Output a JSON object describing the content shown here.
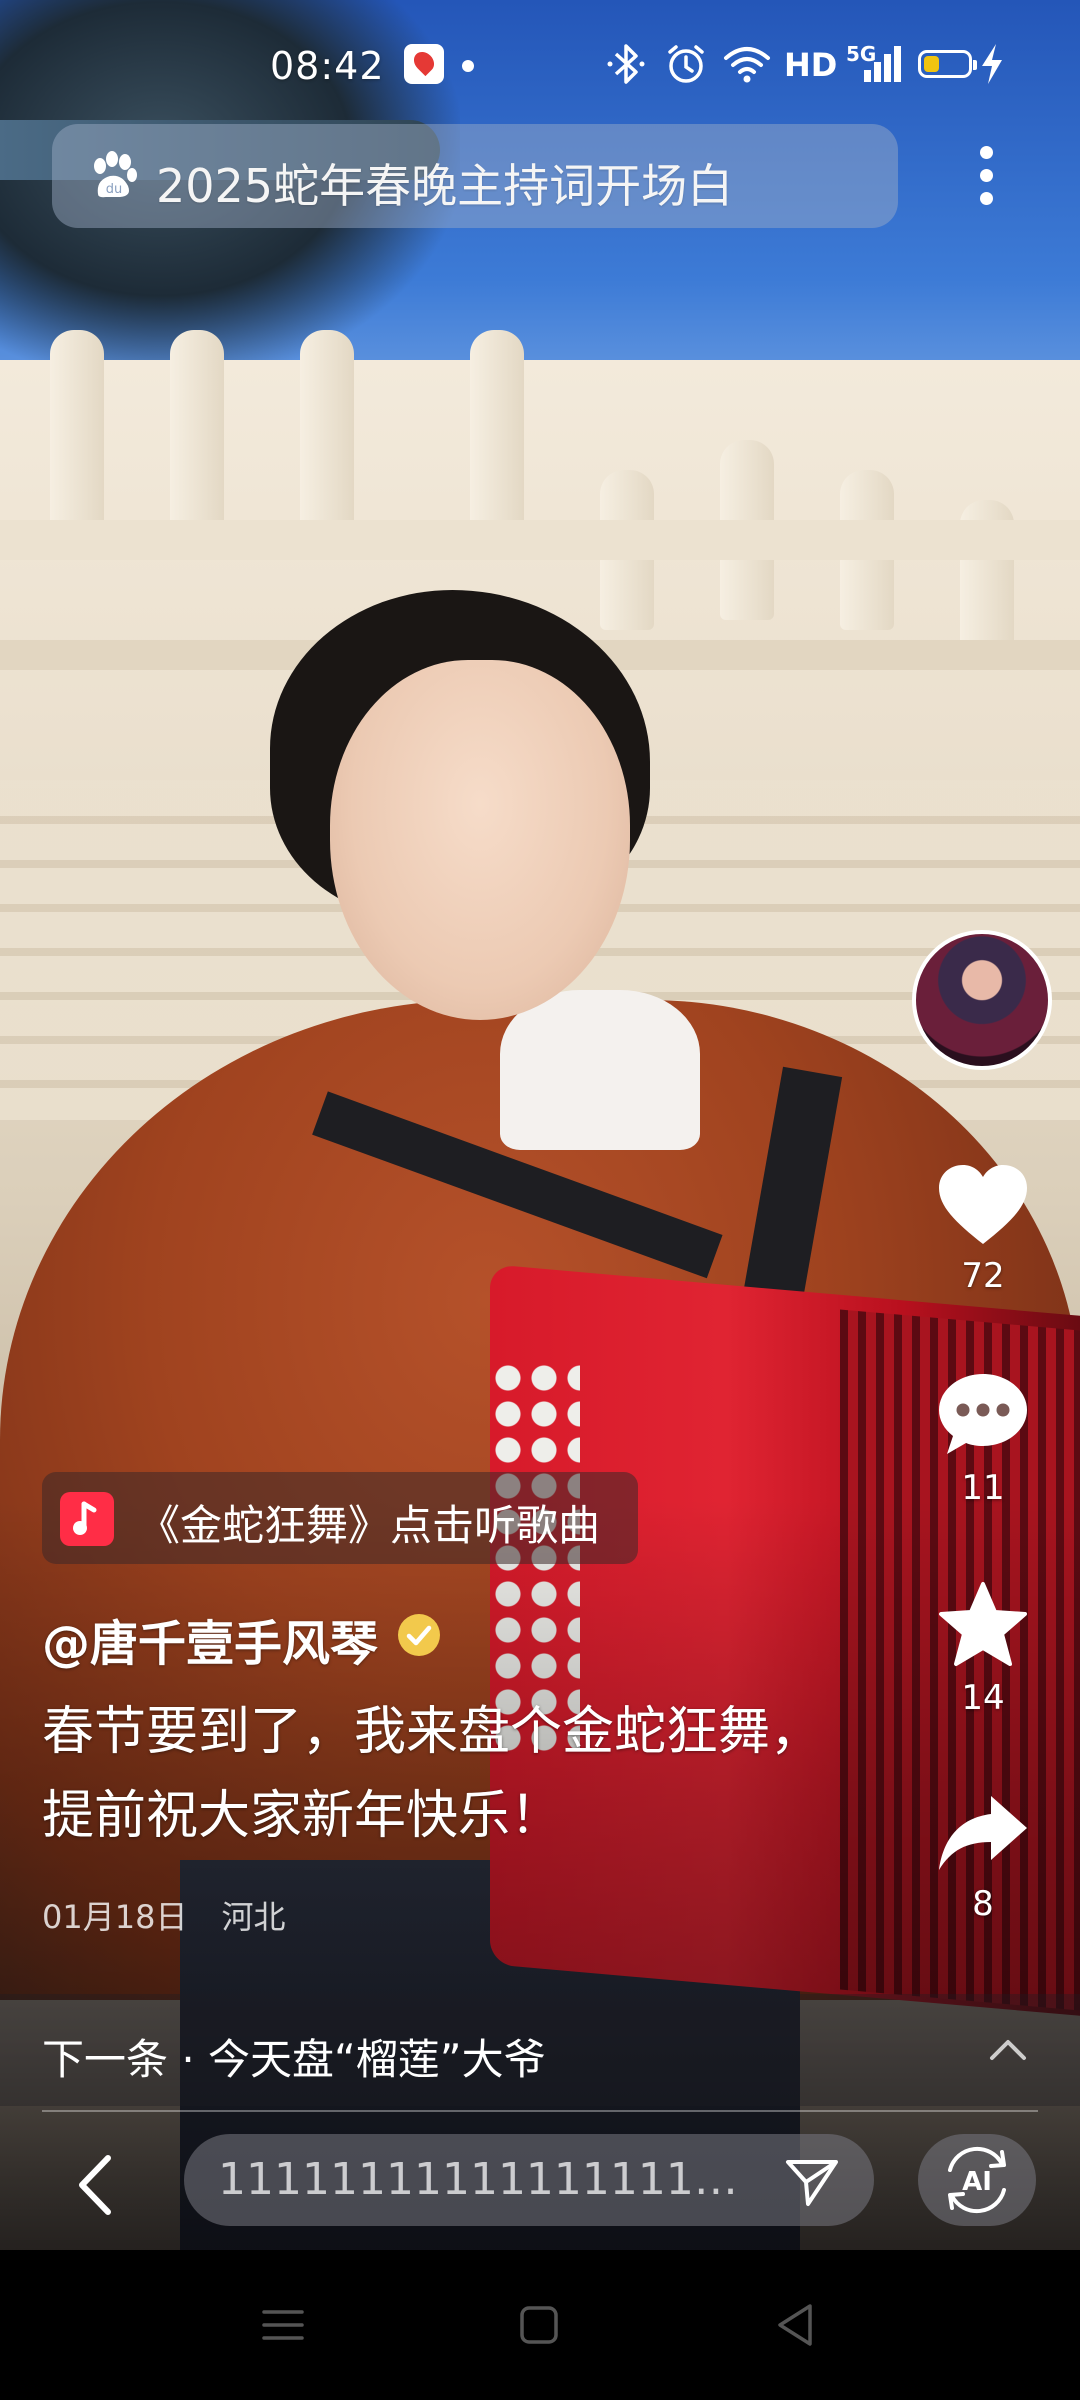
{
  "status_bar": {
    "time": "08:42",
    "network": "HD",
    "signal": "5G",
    "battery_level": 0.35
  },
  "search": {
    "query": "2025蛇年春晚主持词开场白",
    "icon": "baidu-paw-icon"
  },
  "actions": {
    "likes": "72",
    "comments": "11",
    "favorites": "14",
    "shares": "8"
  },
  "music": {
    "label": "《金蛇狂舞》点击听歌曲"
  },
  "post": {
    "author": "@唐千壹手风琴",
    "description": "春节要到了，我来盘个金蛇狂舞，提前祝大家新年快乐！",
    "date": "01月18日",
    "location": "河北"
  },
  "next": {
    "label": "下一条 · 今天盘“榴莲”大爷"
  },
  "comment_input": {
    "value": "11111111111111111111111111111111111"
  },
  "ai_button": {
    "label": "AI"
  },
  "colors": {
    "music_brand": "#ff2d46",
    "verified": "#f2c94c",
    "battery": "#f1c40f"
  }
}
